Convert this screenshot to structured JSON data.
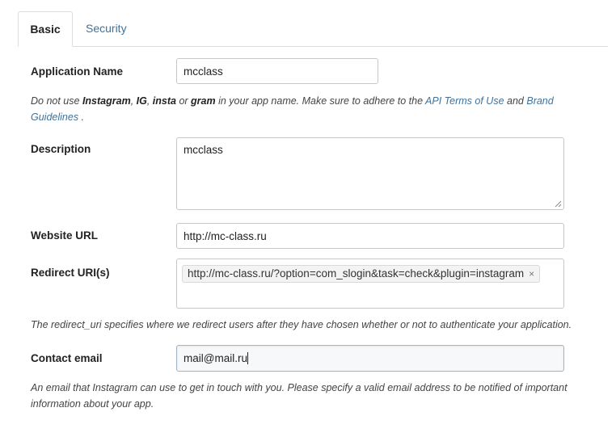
{
  "tabs": [
    {
      "label": "Basic",
      "active": true
    },
    {
      "label": "Security",
      "active": false
    }
  ],
  "form": {
    "app_name": {
      "label": "Application Name",
      "value": "mcclass"
    },
    "name_hint": {
      "p1": "Do not use ",
      "b1": "Instagram",
      "p2": ", ",
      "b2": "IG",
      "p3": ", ",
      "b3": "insta",
      "p4": " or ",
      "b4": "gram",
      "p5": " in your app name. Make sure to adhere to the ",
      "link1": "API Terms of Use",
      "p6": " and ",
      "link2a": "Brand",
      "link2b": "Guidelines",
      "p7": " ."
    },
    "description": {
      "label": "Description",
      "value": "mcclass"
    },
    "website": {
      "label": "Website URL",
      "value": "http://mc-class.ru"
    },
    "redirect": {
      "label": "Redirect URI(s)",
      "tokens": [
        "http://mc-class.ru/?option=com_slogin&task=check&plugin=instagram"
      ],
      "remove_glyph": "×"
    },
    "redirect_hint": "The redirect_uri specifies where we redirect users after they have chosen whether or not to authenticate your application.",
    "email": {
      "label": "Contact email",
      "value": "mail@mail.ru"
    },
    "email_hint_line1": "An email that Instagram can use to get in touch with you. Please specify a valid email address to be notified of important",
    "email_hint_line2": "information about your app."
  }
}
